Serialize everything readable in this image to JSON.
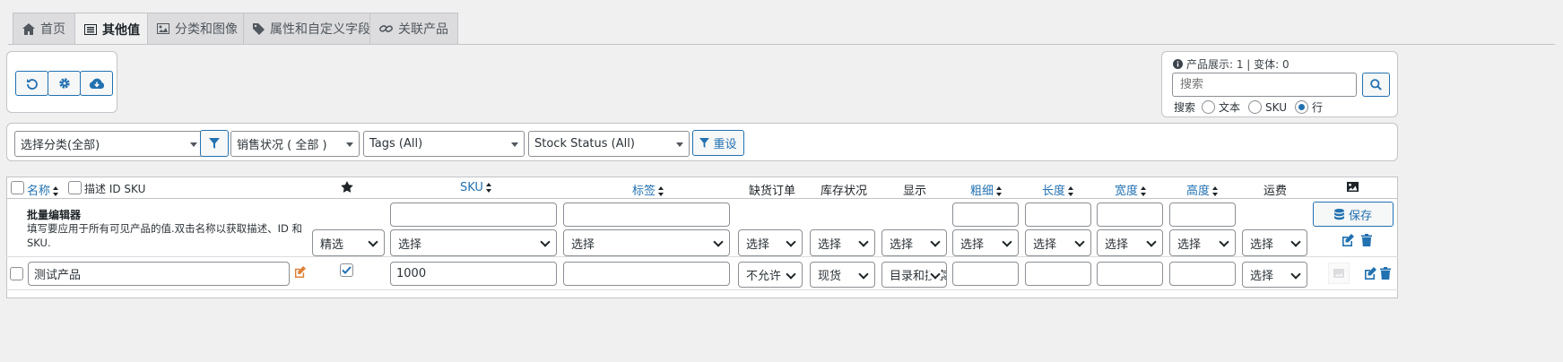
{
  "tabs": [
    {
      "label": "首页",
      "icon": "home-icon"
    },
    {
      "label": "其他值",
      "icon": "list-icon"
    },
    {
      "label": "分类和图像",
      "icon": "image-icon"
    },
    {
      "label": "属性和自定义字段",
      "icon": "tag-icon"
    },
    {
      "label": "关联产品",
      "icon": "link-icon"
    }
  ],
  "info": {
    "text": "产品展示: 1 | 变体: 0"
  },
  "search": {
    "placeholder": "搜索",
    "label": "搜索",
    "options": [
      "文本",
      "SKU",
      "行"
    ],
    "selected": "行"
  },
  "filters": {
    "category": "选择分类(全部)",
    "sale_status": "销售状况 ( 全部 )",
    "tags": "Tags (All)",
    "stock_status": "Stock Status (All)",
    "reset": "重设"
  },
  "columns": {
    "name": "名称",
    "desc_id_sku": "描述 ID SKU",
    "sku": "SKU",
    "tags": "标签",
    "backorders": "缺货订单",
    "stock_status": "库存状况",
    "display": "显示",
    "weight": "粗细",
    "length": "长度",
    "width": "宽度",
    "height": "高度",
    "shipping": "运费"
  },
  "bulk": {
    "title": "批量编辑器",
    "desc": "填写要应用于所有可见产品的值.双击名称以获取描述、ID 和 SKU.",
    "featured": "精选",
    "choose": "选择",
    "save": "保存"
  },
  "row": {
    "name": "测试产品",
    "sku": "1000",
    "backorders": "不允许",
    "stock_status": "现货",
    "display": "目录和搜索",
    "shipping": "选择",
    "featured": true
  },
  "colors": {
    "accent": "#2271b1",
    "edit": "#d63638",
    "orange": "#dd823b"
  }
}
